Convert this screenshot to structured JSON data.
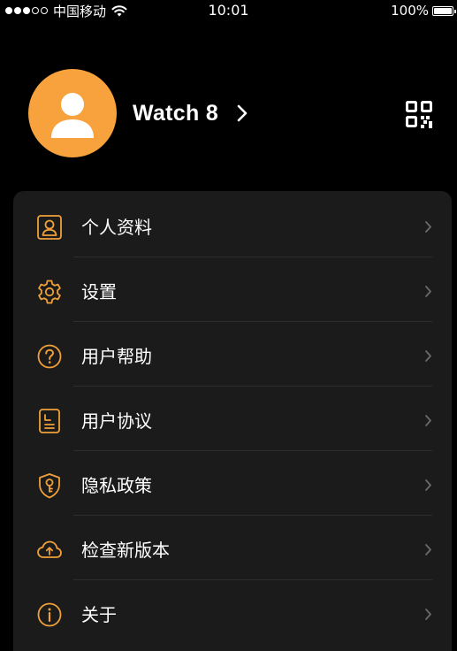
{
  "status_bar": {
    "carrier": "中国移动",
    "time": "10:01",
    "battery_text": "100%",
    "battery_level": 1.0,
    "signal_strength_dots": 3
  },
  "profile": {
    "device_name": "Watch 8",
    "avatar_icon": "user-avatar-icon",
    "avatar_color": "#f7a23c",
    "qr_icon": "qr-code-icon"
  },
  "menu": {
    "accent_color": "#f0a03a",
    "items": [
      {
        "label": "个人资料",
        "icon": "profile-card-icon"
      },
      {
        "label": "设置",
        "icon": "gear-icon"
      },
      {
        "label": "用户帮助",
        "icon": "help-circle-icon"
      },
      {
        "label": "用户协议",
        "icon": "document-icon"
      },
      {
        "label": "隐私政策",
        "icon": "shield-key-icon"
      },
      {
        "label": "检查新版本",
        "icon": "cloud-upload-icon"
      },
      {
        "label": "关于",
        "icon": "info-circle-icon"
      }
    ]
  }
}
